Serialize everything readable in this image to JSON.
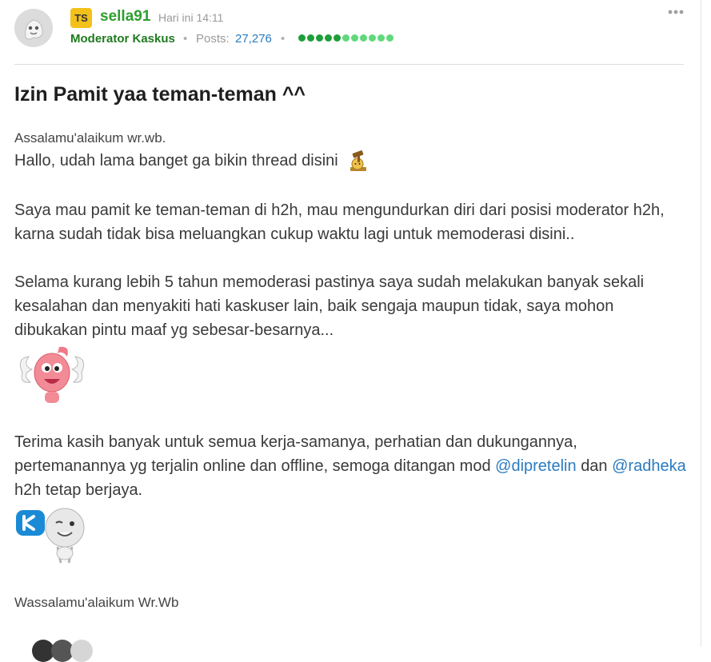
{
  "author": {
    "badge": "TS",
    "username": "sella91",
    "time": "Hari ini 14:11",
    "role": "Moderator Kaskus",
    "posts_label": "Posts:",
    "posts_count": "27,276",
    "separator": "•",
    "reputation_dots": 11
  },
  "menu": {
    "more_icon": "⋮"
  },
  "thread": {
    "title": "Izin Pamit yaa teman-teman ^^",
    "salam_open": "Assalamu'alaikum wr.wb.",
    "greeting": "Hallo, udah lama banget ga bikin thread disini",
    "paragraph_1": "Saya mau pamit ke teman-teman di h2h, mau mengundurkan diri dari posisi moderator h2h, karna sudah tidak bisa meluangkan cukup waktu lagi untuk memoderasi disini..",
    "paragraph_2": "Selama kurang lebih 5 tahun memoderasi pastinya saya sudah melakukan banyak sekali kesalahan dan menyakiti hati kaskuser lain, baik sengaja maupun tidak, saya mohon dibukakan pintu maaf yg sebesar-besarnya...",
    "paragraph_3_text_a": "Terima kasih banyak untuk semua kerja-samanya, perhatian dan dukungannya, pertemanannya yg terjalin online dan offline, semoga ditangan mod",
    "mention_1": "@dipretelin",
    "paragraph_3_text_b": "dan",
    "mention_2": "@radheka",
    "paragraph_3_text_c": "h2h tetap berjaya.",
    "salam_close": "Wassalamu'alaikum Wr.Wb"
  },
  "colors": {
    "username": "#2e9e2e",
    "role": "#1f7a1f",
    "link": "#2b7bc0",
    "badge": "#f3c11b",
    "rep_dark": "#1e9e3a",
    "rep_light": "#5fd97a"
  },
  "icons": [
    "more-menu-icon",
    "avatar-ghost-icon",
    "emoticon-gavel",
    "emoticon-angel",
    "emoticon-kaskus-logo"
  ]
}
